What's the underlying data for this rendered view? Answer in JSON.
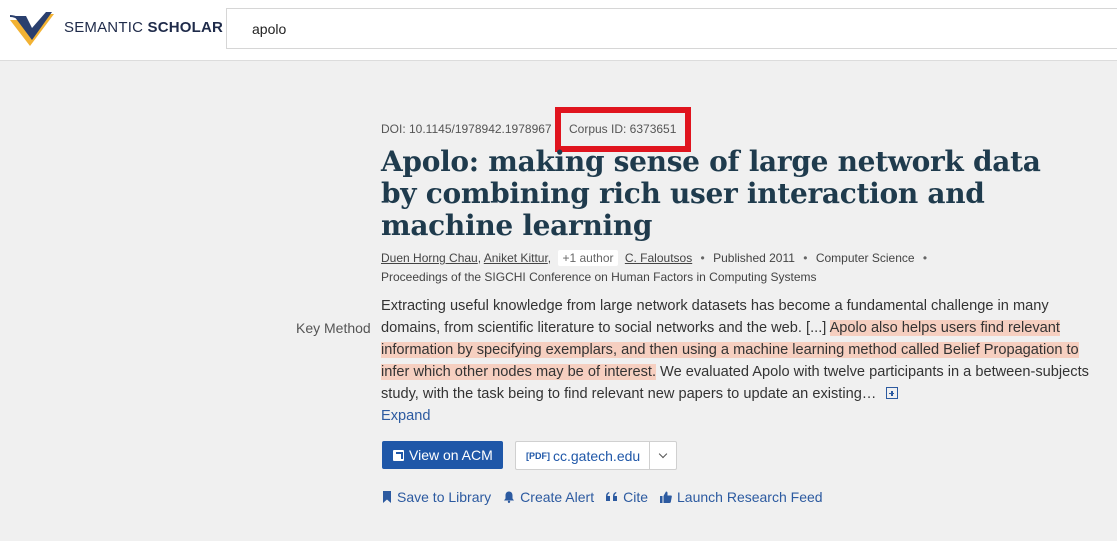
{
  "header": {
    "brand_light": "SEMANTIC",
    "brand_bold": "SCHOLAR",
    "search_value": "apolo",
    "colors": {
      "brand_navy": "#1f2b4a",
      "logo_gold": "#f2b233"
    }
  },
  "paper": {
    "doi": "DOI: 10.1145/1978942.1978967",
    "corpus_id": "Corpus ID: 6373651",
    "title": "Apolo: making sense of large network data by combining rich user interaction and machine learning",
    "authors": [
      "Duen Horng Chau",
      "Aniket Kittur",
      "C. Faloutsos"
    ],
    "more_authors": "+1 author",
    "published": "Published 2011",
    "field": "Computer Science",
    "venue": "Proceedings of the SIGCHI Conference on Human Factors in Computing Systems",
    "key_method_label": "Key Method",
    "abstract_before": "Extracting useful knowledge from large network datasets has become a fundamental challenge in many domains, from scientific literature to social networks and the web. [...] ",
    "abstract_highlight": "Apolo also helps users find relevant information by specifying exemplars, and then using a machine learning method called Belief Propagation to infer which other nodes may be of interest.",
    "abstract_after": " We evaluated Apolo with twelve participants in a between-subjects study, with the task being to find relevant new papers to update an existing…",
    "expand_label": "Expand"
  },
  "buttons": {
    "view_acm": "View on ACM",
    "pdf_tag": "[PDF]",
    "pdf_source": "cc.gatech.edu"
  },
  "actions": {
    "save": "Save to Library",
    "alert": "Create Alert",
    "cite": "Cite",
    "feed": "Launch Research Feed"
  },
  "colors": {
    "highlight": "#e0141e",
    "primary": "#1f57a8",
    "title": "#1f3b4d",
    "abstract_highlight_bg": "#f6cfc0"
  }
}
